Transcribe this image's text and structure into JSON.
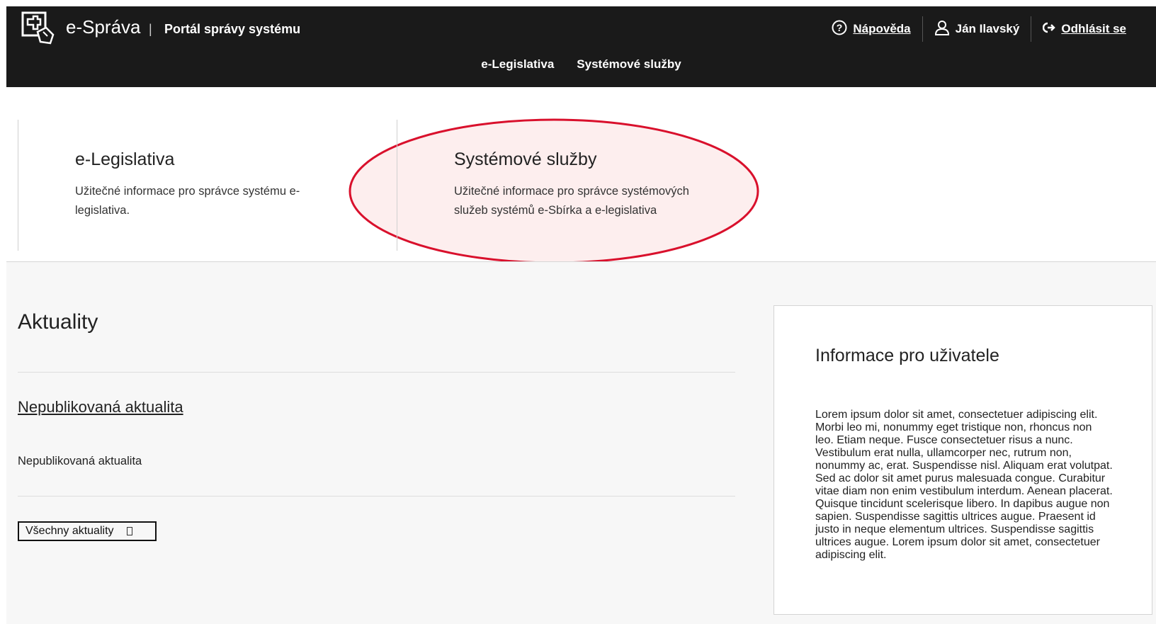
{
  "header": {
    "brand": "e-Správa",
    "separator": "|",
    "subtitle": "Portál správy systému",
    "help_label": "Nápověda",
    "user_name": "Ján Ilavský",
    "logout_label": "Odhlásit se",
    "nav": [
      {
        "label": "e-Legislativa"
      },
      {
        "label": "Systémové služby"
      }
    ]
  },
  "cards": [
    {
      "title": "e-Legislativa",
      "description": "Užitečné informace pro správce systému e-legislativa."
    },
    {
      "title": "Systémové služby",
      "description": "Užitečné informace pro správce systémových služeb systémů e-Sbírka a e-legislativa",
      "highlighted": true
    }
  ],
  "news": {
    "title": "Aktuality",
    "items": [
      {
        "link_label": "Nepublikovaná aktualita",
        "text": "Nepublikovaná aktualita"
      }
    ],
    "all_button_label": "Všechny aktuality"
  },
  "info": {
    "title": "Informace pro uživatele",
    "text": "Lorem ipsum dolor sit amet, consectetuer adipiscing elit. Morbi leo mi, nonummy eget tristique non, rhoncus non leo. Etiam neque. Fusce consectetuer risus a nunc. Vestibulum erat nulla, ullamcorper nec, rutrum non, nonummy ac, erat. Suspendisse nisl. Aliquam erat volutpat. Sed ac dolor sit amet purus malesuada congue. Curabitur vitae diam non enim vestibulum interdum. Aenean placerat. Quisque tincidunt scelerisque libero. In dapibus augue non sapien. Suspendisse sagittis ultrices augue. Praesent id justo in neque elementum ultrices. Suspendisse sagittis ultrices augue. Lorem ipsum dolor sit amet, consectetuer adipiscing elit."
  },
  "colors": {
    "header_bg": "#1a1a1a",
    "highlight_stroke": "#d9102c",
    "highlight_fill": "#fdeeee"
  },
  "icons": [
    "app-logo-icon",
    "help-icon",
    "user-icon",
    "logout-icon"
  ]
}
